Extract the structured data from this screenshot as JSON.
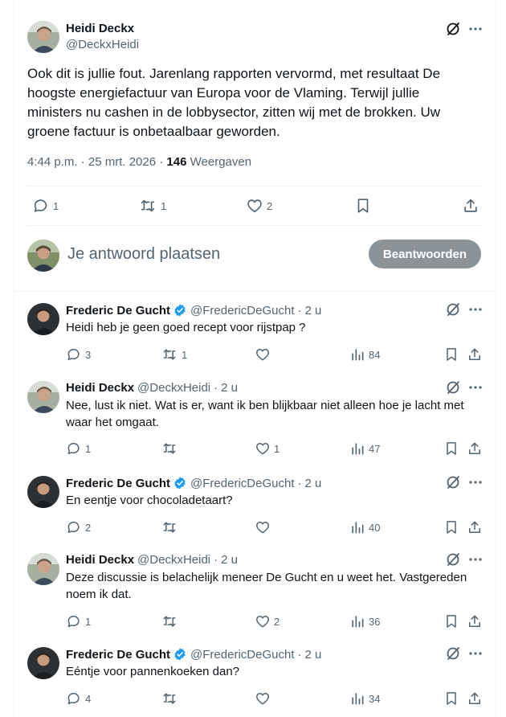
{
  "main_tweet": {
    "author_name": "Heidi Deckx",
    "author_handle": "@DeckxHeidi",
    "text": "Ook dit is jullie fout. Jarenlang rapporten vervormd, met resultaat De hoogste energiefactuur van Europa voor de Vlaming. Terwijl jullie ministers nu cashen in de lobbysector, zitten wij met de brokken. Uw groene factuur is onbetaalbaar geworden.",
    "timestamp": "4:44 p.m. · 25 mrt. 2026 ·",
    "views_count": "146",
    "views_label": "Weergaven",
    "replies": "1",
    "reposts": "1",
    "likes": "2"
  },
  "compose": {
    "placeholder": "Je antwoord plaatsen",
    "button_label": "Beantwoorden"
  },
  "replies": [
    {
      "name": "Frederic De Gucht",
      "verified": true,
      "handle": "@FredericDeGucht",
      "time": "2 u",
      "text": "Heidi heb je geen goed recept voor rijstpap ?",
      "replies": "3",
      "reposts": "1",
      "likes": "",
      "views": "84"
    },
    {
      "name": "Heidi Deckx",
      "verified": false,
      "handle": "@DeckxHeidi",
      "time": "2 u",
      "text": "Nee, lust ik niet. Wat is er, want ik ben blijkbaar niet alleen hoe je lacht met waar het omgaat.",
      "replies": "1",
      "reposts": "",
      "likes": "1",
      "views": "47"
    },
    {
      "name": "Frederic De Gucht",
      "verified": true,
      "handle": "@FredericDeGucht",
      "time": "2 u",
      "text": "En eentje voor chocoladetaart?",
      "replies": "2",
      "reposts": "",
      "likes": "",
      "views": "40"
    },
    {
      "name": "Heidi Deckx",
      "verified": false,
      "handle": "@DeckxHeidi",
      "time": "2 u",
      "text": "Deze discussie is belachelijk meneer De Gucht en u weet het. Vastgereden noem ik dat.",
      "replies": "1",
      "reposts": "",
      "likes": "2",
      "views": "36"
    },
    {
      "name": "Frederic De Gucht",
      "verified": true,
      "handle": "@FredericDeGucht",
      "time": "2 u",
      "text": "Eéntje voor pannenkoeken dan?",
      "replies": "4",
      "reposts": "",
      "likes": "",
      "views": "34"
    }
  ],
  "colors": {
    "text": "#0f1419",
    "muted": "#536471",
    "verified": "#1d9bf0",
    "button": "#8b9298",
    "divider": "#eff3f4"
  }
}
